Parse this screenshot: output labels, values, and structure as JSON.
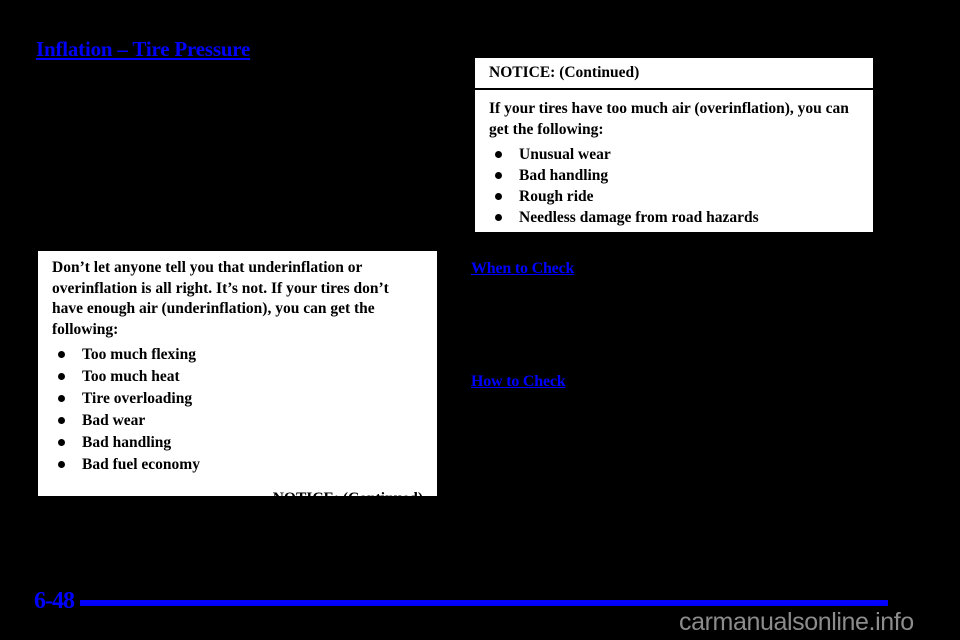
{
  "page": {
    "background_color": "#000000",
    "accent_color": "#0000ff",
    "title": "Inflation – Tire Pressure",
    "footer": {
      "page_number": "6-48",
      "watermark": "carmanualsonline.info",
      "rule_color": "#0000ff"
    }
  },
  "left_column": {
    "notice_box": {
      "paragraph": "Don’t let anyone tell you that underinflation or overinflation is all right. It’s not. If your tires don’t have enough air (underinflation), you can get the following:",
      "bullets": [
        "Too much flexing",
        "Too much heat",
        "Tire overloading",
        "Bad wear",
        "Bad handling",
        "Bad fuel economy"
      ],
      "continued_label": "NOTICE: (Continued)"
    }
  },
  "right_column": {
    "notice_box": {
      "header": "NOTICE: (Continued)",
      "paragraph": "If your tires have too much air (overinflation), you can get the following:",
      "bullets": [
        "Unusual wear",
        "Bad handling",
        "Rough ride",
        "Needless damage from road hazards"
      ]
    },
    "headings": {
      "when_to_check": "When to Check",
      "how_to_check": "How to Check"
    }
  }
}
